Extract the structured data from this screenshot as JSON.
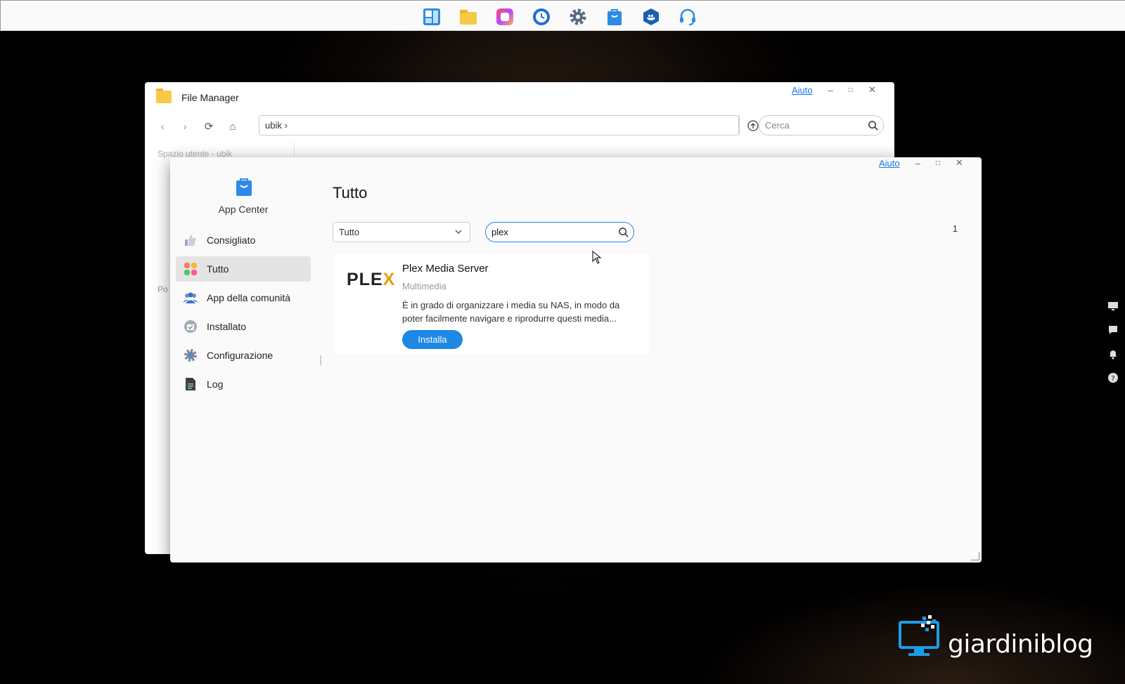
{
  "taskbar": {
    "icons": [
      "dashboard-icon",
      "folder-icon",
      "photos-icon",
      "backup-clock-icon",
      "settings-gear-icon",
      "app-store-bag-icon",
      "docker-icon",
      "support-headset-icon"
    ]
  },
  "file_manager": {
    "title": "File Manager",
    "help": "Aiuto",
    "path": "ubik",
    "search_placeholder": "Cerca",
    "side_label": "Spazio utente - ubik",
    "side_label_2": "Po"
  },
  "app_center": {
    "app_name": "App Center",
    "help": "Aiuto",
    "nav": [
      {
        "label": "Consigliato",
        "icon": "thumbs-up-icon"
      },
      {
        "label": "Tutto",
        "icon": "grid-apps-icon"
      },
      {
        "label": "App della comunità",
        "icon": "community-icon"
      },
      {
        "label": "Installato",
        "icon": "installed-icon"
      },
      {
        "label": "Configurazione",
        "icon": "gear-icon"
      },
      {
        "label": "Log",
        "icon": "log-icon"
      }
    ],
    "active_nav": "Tutto",
    "page_title": "Tutto",
    "category_selected": "Tutto",
    "search_value": "plex",
    "page_number": "1",
    "result": {
      "logo": "PLE",
      "logo_x": "X",
      "name": "Plex Media Server",
      "category": "Multimedia",
      "description": "È in grado di organizzare i media su NAS, in modo da poter facilmente navigare e riprodurre questi media...",
      "action": "Installa"
    }
  },
  "watermark": {
    "text": "giardiniblog"
  },
  "colors": {
    "accent": "#1e88e5",
    "plex": "#e5a00d"
  }
}
